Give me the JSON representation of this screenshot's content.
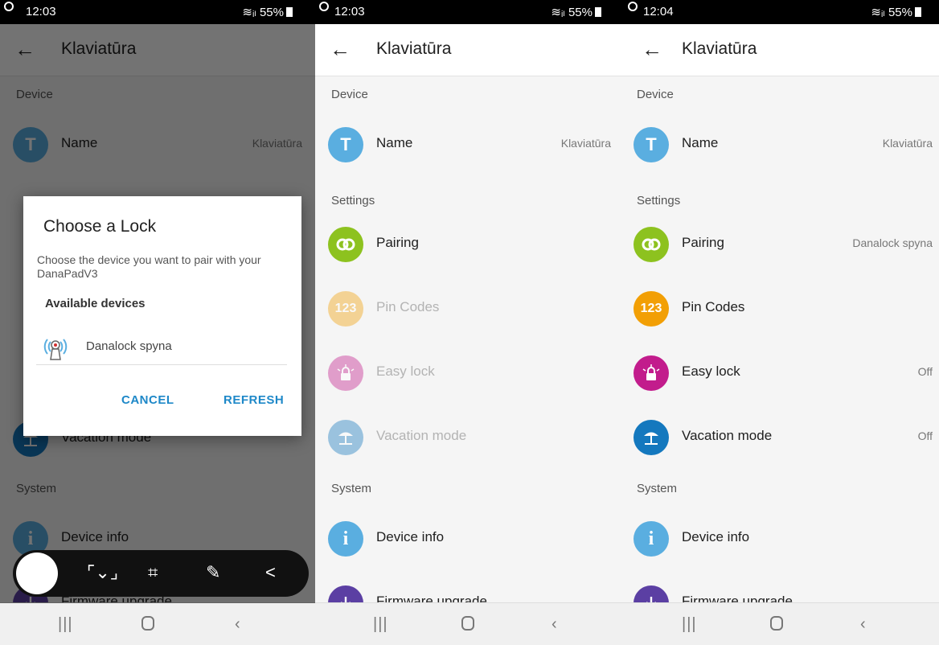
{
  "status": [
    {
      "time": "12:03",
      "battery": "55%"
    },
    {
      "time": "12:03",
      "battery": "55%"
    },
    {
      "time": "12:04",
      "battery": "55%"
    }
  ],
  "header": {
    "back_glyph": "←",
    "title": "Klaviatūra"
  },
  "sections": {
    "device": "Device",
    "settings": "Settings",
    "system": "System"
  },
  "rows": {
    "name": {
      "label": "Name",
      "value": "Klaviatūra",
      "icon": "T"
    },
    "pairing": {
      "label": "Pairing",
      "value_paired": "Danalock spyna"
    },
    "pin": {
      "label": "Pin Codes",
      "icon": "123"
    },
    "easy": {
      "label": "Easy lock",
      "value": "Off"
    },
    "vacation": {
      "label": "Vacation mode",
      "value": "Off"
    },
    "info": {
      "label": "Device info",
      "icon": "i"
    },
    "firmware": {
      "label": "Firmware upgrade"
    }
  },
  "dialog": {
    "title": "Choose a Lock",
    "message": "Choose the device you want to pair with your DanaPadV3",
    "available": "Available devices",
    "device": "Danalock spyna",
    "cancel": "CANCEL",
    "refresh": "REFRESH"
  },
  "colors": {
    "name": "#5aaee0",
    "pairing": "#8dc21f",
    "pin": "#f29f05",
    "easy": "#c21c8c",
    "vacation": "#1478be",
    "info": "#5aaee0",
    "firmware": "#5b3fa3",
    "link": "#1e88c8"
  },
  "icons": [
    "back-arrow-icon",
    "name-letter-icon",
    "pairing-link-icon",
    "pin-codes-icon",
    "easy-lock-icon",
    "vacation-beach-icon",
    "info-icon",
    "firmware-download-icon",
    "lock-signal-icon",
    "scroll-capture-icon",
    "crop-icon",
    "pen-icon",
    "share-icon",
    "recent-apps-icon",
    "home-icon",
    "nav-back-icon"
  ]
}
